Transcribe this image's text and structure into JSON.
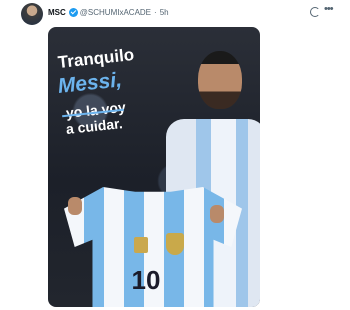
{
  "post": {
    "author_name": "MSC",
    "handle": "@SCHUMIxACADE",
    "separator": "·",
    "time": "5h",
    "more_label": "•••"
  },
  "media": {
    "caption_line1": "Tranquilo",
    "caption_line2": "Messi,",
    "caption_line3": "yo la voy",
    "caption_line4": "a cuidar.",
    "jersey_number": "10"
  },
  "icons": {
    "verified": "verified-badge-icon",
    "grok": "grok-icon",
    "more": "more-options-icon"
  },
  "colors": {
    "verified": "#1d9bf0",
    "accent_text": "#6cb4ee"
  }
}
